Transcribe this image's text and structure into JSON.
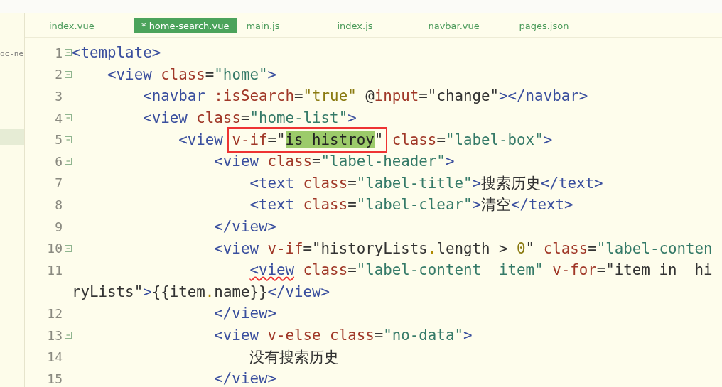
{
  "sidebar": {
    "label": "oc-ne"
  },
  "tabs": [
    {
      "label": "index.vue",
      "selected": false
    },
    {
      "label": "* home-search.vue",
      "selected": true
    },
    {
      "label": "main.js",
      "selected": false
    },
    {
      "label": "index.js",
      "selected": false
    },
    {
      "label": "navbar.vue",
      "selected": false
    },
    {
      "label": "pages.json",
      "selected": false
    }
  ],
  "lines": [
    {
      "number": "1",
      "foldable": true,
      "tokens": [
        {
          "t": "<template>",
          "kind": "tag"
        }
      ]
    },
    {
      "number": "2",
      "foldable": true,
      "tokens": [
        {
          "t": "    <view",
          "kind": "tag"
        },
        {
          "t": " class",
          "kind": "attr"
        },
        {
          "t": "=",
          "kind": "plain"
        },
        {
          "t": "\"home\"",
          "kind": "str"
        },
        {
          "t": ">",
          "kind": "tag"
        }
      ]
    },
    {
      "number": "3",
      "foldable": false,
      "tokens": [
        {
          "t": "        <navbar",
          "kind": "tag"
        },
        {
          "t": " :isSearch",
          "kind": "attr"
        },
        {
          "t": "=",
          "kind": "plain"
        },
        {
          "t": "\"true\"",
          "kind": "val"
        },
        {
          "t": " @",
          "kind": "plain"
        },
        {
          "t": "input",
          "kind": "attr"
        },
        {
          "t": "=\"change\"",
          "kind": "plain"
        },
        {
          "t": "></navbar>",
          "kind": "tag"
        }
      ]
    },
    {
      "number": "4",
      "foldable": true,
      "tokens": [
        {
          "t": "        <view",
          "kind": "tag"
        },
        {
          "t": " class",
          "kind": "attr"
        },
        {
          "t": "=",
          "kind": "plain"
        },
        {
          "t": "\"home-list\"",
          "kind": "str"
        },
        {
          "t": ">",
          "kind": "tag"
        }
      ]
    },
    {
      "number": "5",
      "foldable": true,
      "tokens": [
        {
          "t": "            <view ",
          "kind": "tag"
        },
        {
          "kind": "annotation",
          "tokens": [
            {
              "t": "v-if",
              "kind": "attr"
            },
            {
              "t": "=\"",
              "kind": "plain"
            },
            {
              "t": "is_histroy",
              "kind": "match"
            },
            {
              "t": "\"",
              "kind": "plain"
            }
          ]
        },
        {
          "t": " class",
          "kind": "attr"
        },
        {
          "t": "=",
          "kind": "plain"
        },
        {
          "t": "\"label-box\"",
          "kind": "str"
        },
        {
          "t": ">",
          "kind": "tag"
        }
      ]
    },
    {
      "number": "6",
      "foldable": true,
      "tokens": [
        {
          "t": "                <view",
          "kind": "tag"
        },
        {
          "t": " class",
          "kind": "attr"
        },
        {
          "t": "=",
          "kind": "plain"
        },
        {
          "t": "\"label-header\"",
          "kind": "str"
        },
        {
          "t": ">",
          "kind": "tag"
        }
      ]
    },
    {
      "number": "7",
      "foldable": false,
      "tokens": [
        {
          "t": "                    <text",
          "kind": "tag"
        },
        {
          "t": " class",
          "kind": "attr"
        },
        {
          "t": "=",
          "kind": "plain"
        },
        {
          "t": "\"label-title\"",
          "kind": "str"
        },
        {
          "t": ">",
          "kind": "tag"
        },
        {
          "t": "搜索历史",
          "kind": "plain"
        },
        {
          "t": "</text>",
          "kind": "tag"
        }
      ]
    },
    {
      "number": "8",
      "foldable": false,
      "tokens": [
        {
          "t": "                    <text",
          "kind": "tag"
        },
        {
          "t": " class",
          "kind": "attr"
        },
        {
          "t": "=",
          "kind": "plain"
        },
        {
          "t": "\"label-clear\"",
          "kind": "str"
        },
        {
          "t": ">",
          "kind": "tag"
        },
        {
          "t": "清空",
          "kind": "plain"
        },
        {
          "t": "</text>",
          "kind": "tag"
        }
      ]
    },
    {
      "number": "9",
      "foldable": false,
      "tokens": [
        {
          "t": "                </view>",
          "kind": "tag"
        }
      ]
    },
    {
      "number": "10",
      "foldable": true,
      "tokens": [
        {
          "t": "                <view",
          "kind": "tag"
        },
        {
          "t": " v-if",
          "kind": "attr"
        },
        {
          "t": "=\"historyLists",
          "kind": "plain"
        },
        {
          "t": ".",
          "kind": "dot"
        },
        {
          "t": "length > ",
          "kind": "plain"
        },
        {
          "t": "0",
          "kind": "val"
        },
        {
          "t": "\"",
          "kind": "plain"
        },
        {
          "t": " class",
          "kind": "attr"
        },
        {
          "t": "=",
          "kind": "plain"
        },
        {
          "t": "\"label-conten",
          "kind": "str"
        }
      ]
    },
    {
      "number": "11",
      "foldable": false,
      "tokens": [
        {
          "t": "                    <view",
          "kind": "tag",
          "squiggle": true
        },
        {
          "t": " class",
          "kind": "attr"
        },
        {
          "t": "=",
          "kind": "plain"
        },
        {
          "t": "\"label-content__item\"",
          "kind": "str"
        },
        {
          "t": " v-for",
          "kind": "attr"
        },
        {
          "t": "=\"item in  hi",
          "kind": "plain"
        }
      ],
      "continuation": [
        {
          "t": "ryLists\"",
          "kind": "plain"
        },
        {
          "t": ">",
          "kind": "tag"
        },
        {
          "t": "{{item",
          "kind": "plain"
        },
        {
          "t": ".",
          "kind": "dot"
        },
        {
          "t": "name}}",
          "kind": "plain"
        },
        {
          "t": "</view>",
          "kind": "tag"
        }
      ]
    },
    {
      "number": "12",
      "foldable": false,
      "tokens": [
        {
          "t": "                </view>",
          "kind": "tag"
        }
      ]
    },
    {
      "number": "13",
      "foldable": true,
      "tokens": [
        {
          "t": "                <view",
          "kind": "tag"
        },
        {
          "t": " v-else",
          "kind": "attr"
        },
        {
          "t": " class",
          "kind": "attr"
        },
        {
          "t": "=",
          "kind": "plain"
        },
        {
          "t": "\"no-data\"",
          "kind": "str"
        },
        {
          "t": ">",
          "kind": "tag"
        }
      ]
    },
    {
      "number": "14",
      "foldable": false,
      "tokens": [
        {
          "t": "                    没有搜索历史",
          "kind": "plain"
        }
      ]
    },
    {
      "number": "15",
      "foldable": false,
      "tokens": [
        {
          "t": "                </view>",
          "kind": "tag"
        }
      ]
    }
  ]
}
